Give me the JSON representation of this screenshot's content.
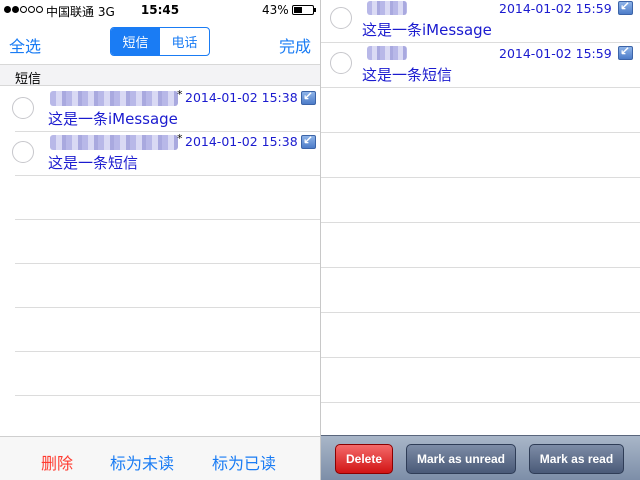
{
  "status_bar": {
    "signal_dots": [
      true,
      true,
      false,
      false,
      false
    ],
    "carrier": "中国联通  3G",
    "time": "15:45",
    "battery_percent": "43%",
    "battery_level": 0.43
  },
  "navbar": {
    "select_all": "全选",
    "segments": [
      "短信",
      "电话"
    ],
    "active_segment": "短信",
    "done": "完成",
    "accent_color": "#1a7cf4"
  },
  "left_list": {
    "section_title": "短信",
    "messages": [
      {
        "star": "*",
        "date": "2014-01-02 15:38",
        "body": "这是一条iMessage"
      },
      {
        "star": "*",
        "date": "2014-01-02 15:38",
        "body": "这是一条短信"
      }
    ]
  },
  "left_toolbar": {
    "delete": "删除",
    "mark_unread": "标为未读",
    "mark_read": "标为已读",
    "delete_color": "#ff3b30"
  },
  "right_list": {
    "messages": [
      {
        "date": "2014-01-02 15:59",
        "body": "这是一条iMessage"
      },
      {
        "date": "2014-01-02 15:59",
        "body": "这是一条短信"
      }
    ]
  },
  "right_toolbar": {
    "delete": "Delete",
    "mark_unread": "Mark as unread",
    "mark_read": "Mark as read"
  },
  "icons": {
    "reply": "reply-arrow-icon",
    "radio": "radio-circle-icon"
  }
}
